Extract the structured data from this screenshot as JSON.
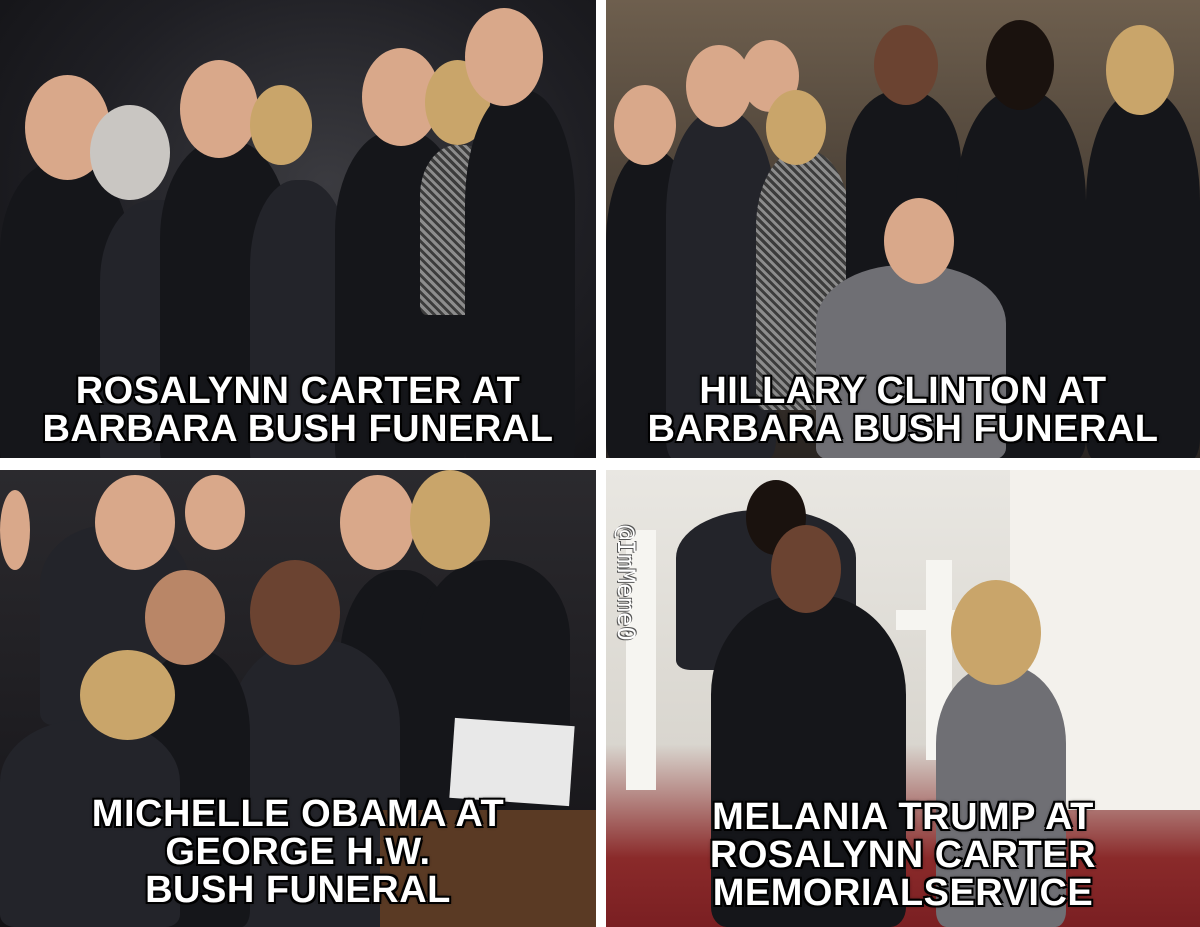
{
  "panels": [
    {
      "caption": [
        "ROSALYNN CARTER AT",
        "BARBARA BUSH FUNERAL"
      ]
    },
    {
      "caption": [
        "HILLARY CLINTON AT",
        "BARBARA BUSH FUNERAL"
      ]
    },
    {
      "caption": [
        "MICHELLE OBAMA AT",
        "GEORGE H.W.",
        "BUSH FUNERAL"
      ]
    },
    {
      "caption": [
        "MELANIA TRUMP AT",
        "ROSALYNN CARTER",
        "MEMORIALSERVICE"
      ]
    }
  ],
  "watermark": "@ImMeme0"
}
